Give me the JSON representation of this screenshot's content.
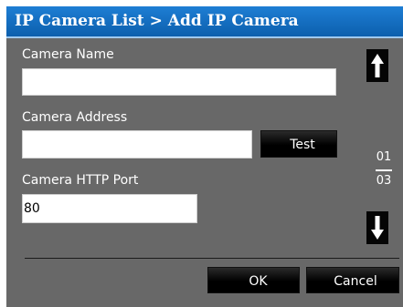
{
  "title": "IP Camera List > Add IP Camera",
  "fields": {
    "name": {
      "label": "Camera Name",
      "value": ""
    },
    "address": {
      "label": "Camera Address",
      "value": ""
    },
    "port": {
      "label": "Camera HTTP Port",
      "value": "80"
    }
  },
  "test_label": "Test",
  "pager": {
    "current": "01",
    "total": "03"
  },
  "icons": {
    "up": "up-arrow-icon",
    "down": "down-arrow-icon"
  },
  "actions": {
    "ok_label": "OK",
    "cancel_label": "Cancel"
  },
  "colors": {
    "title_bar": "#1572c8",
    "panel_background": "#686868",
    "button_background": "#000000"
  }
}
